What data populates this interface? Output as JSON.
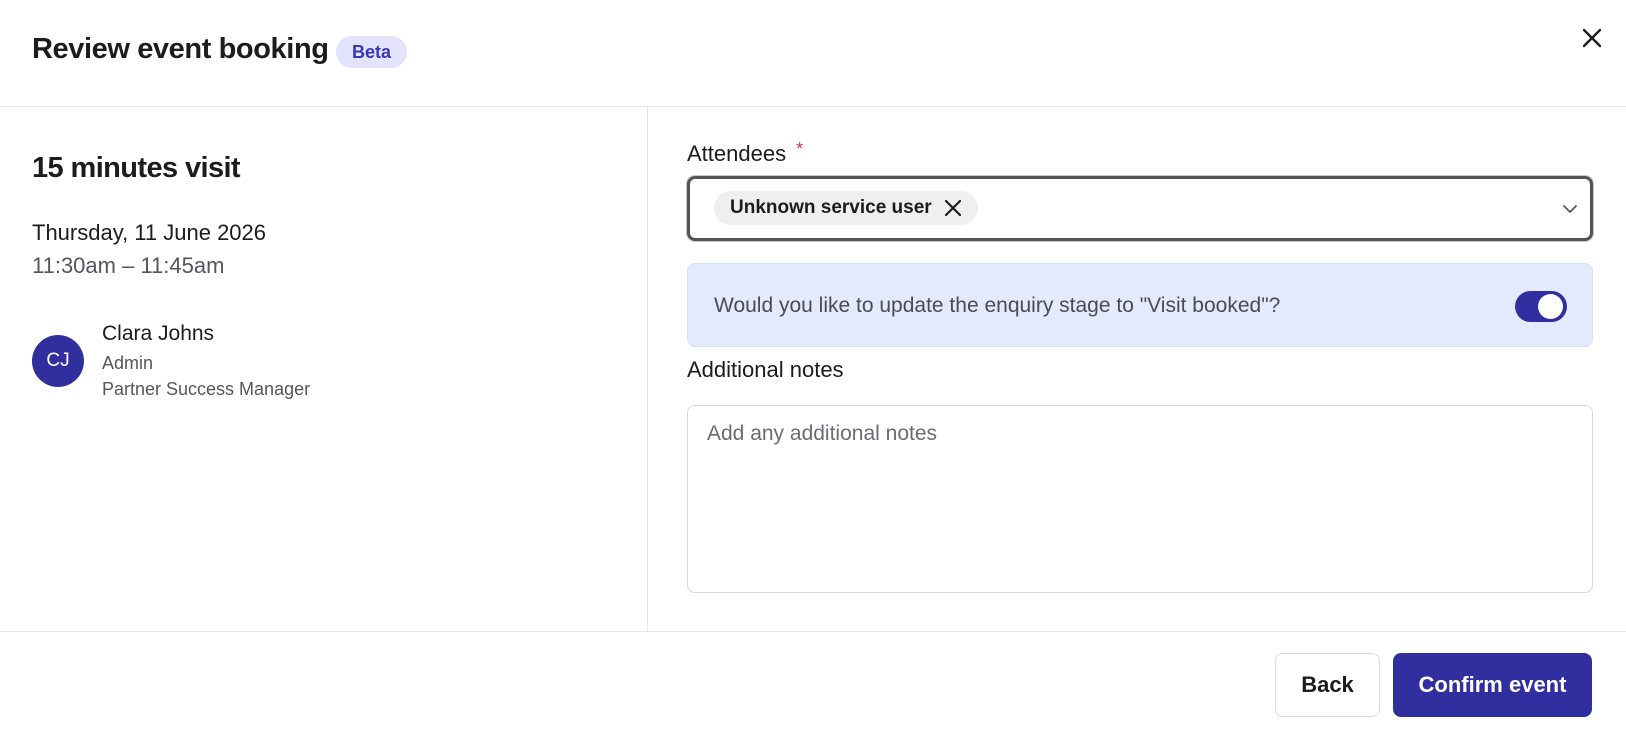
{
  "header": {
    "title": "Review event booking",
    "badge": "Beta",
    "close_icon": "close-icon"
  },
  "event": {
    "title": "15 minutes visit",
    "date": "Thursday, 11 June 2026",
    "time": "11:30am – 11:45am"
  },
  "organizer": {
    "initials": "CJ",
    "name": "Clara Johns",
    "role": "Admin",
    "job_title": "Partner Success Manager",
    "avatar_color": "#312fa0"
  },
  "attendees": {
    "label": "Attendees",
    "required_mark": "*",
    "selected": [
      {
        "label": "Unknown service user"
      }
    ],
    "dropdown_icon": "chevron-down-icon",
    "remove_icon": "close-icon"
  },
  "enquiry_banner": {
    "text": "Would you like to update the enquiry stage to \"Visit booked\"?",
    "toggle_on": true,
    "background": "#e2eafb"
  },
  "notes": {
    "label": "Additional notes",
    "value": "",
    "placeholder": "Add any additional notes"
  },
  "footer": {
    "back_label": "Back",
    "confirm_label": "Confirm event"
  },
  "colors": {
    "accent": "#312fa0",
    "badge_bg": "#e3e4fb",
    "badge_text": "#3b35b8",
    "required": "#d23a3a"
  }
}
